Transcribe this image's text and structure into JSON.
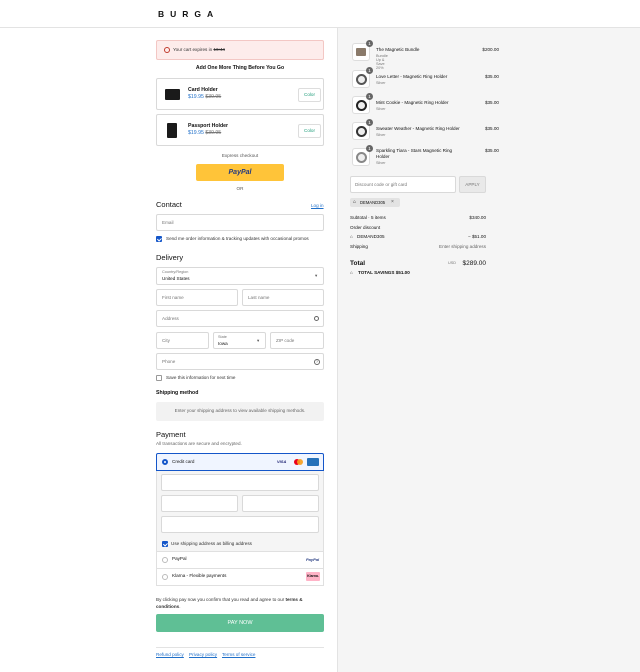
{
  "brand": "BURGA",
  "timer": {
    "prefix": "Your cart expires in",
    "value": "16:44"
  },
  "upsell": {
    "title": "Add One More Thing Before You Go",
    "items": [
      {
        "name": "Card Holder",
        "sale": "$19.95",
        "orig": "$39.95",
        "btn": "Color"
      },
      {
        "name": "Passport Holder",
        "sale": "$19.95",
        "orig": "$39.95",
        "btn": "Color"
      }
    ]
  },
  "express": {
    "label": "Express checkout",
    "paypal": "PayPal",
    "or": "OR"
  },
  "contact": {
    "title": "Contact",
    "login": "Log in",
    "email_ph": "Email",
    "optin": "Send me order information & tracking updates with occasional promos"
  },
  "delivery": {
    "title": "Delivery",
    "country_label": "Country/Region",
    "country": "United States",
    "first_ph": "First name",
    "last_ph": "Last name",
    "address_ph": "Address",
    "city_ph": "City",
    "state_label": "State",
    "state": "Iowa",
    "zip_ph": "ZIP code",
    "phone_ph": "Phone",
    "save": "Save this information for next time"
  },
  "shipping": {
    "title": "Shipping method",
    "msg": "Enter your shipping address to view available shipping methods."
  },
  "payment": {
    "title": "Payment",
    "sub": "All transactions are secure and encrypted.",
    "credit": "Credit card",
    "visa": "VISA",
    "billing": "Use shipping address as billing address",
    "paypal": "PayPal",
    "klarna": "Klarna - Flexible payments",
    "klarna_badge": "Klarna."
  },
  "legal": {
    "pre": "By clicking pay now you confirm that you read and agree to our",
    "terms": "terms & conditions",
    "end": "."
  },
  "paynow": "PAY NOW",
  "footer": [
    "Refund policy",
    "Privacy policy",
    "Terms of service"
  ],
  "cart": {
    "items": [
      {
        "qty": "1",
        "name": "The Magnetic Bundle",
        "variant": "Bundle Up & Save 20%",
        "price": "$200.00"
      },
      {
        "qty": "1",
        "name": "Love Letter - Magnetic Ring Holder",
        "variant": "Silver",
        "price": "$35.00"
      },
      {
        "qty": "1",
        "name": "Mint Cookie - Magnetic Ring Holder",
        "variant": "Silver",
        "price": "$35.00"
      },
      {
        "qty": "1",
        "name": "Sweater Weather - Magnetic Ring Holder",
        "variant": "Silver",
        "price": "$35.00"
      },
      {
        "qty": "1",
        "name": "Sparkling Tiara - Stars Magnetic Ring Holder",
        "variant": "Silver",
        "price": "$35.00"
      }
    ]
  },
  "discount": {
    "ph": "Discount code or gift card",
    "apply": "APPLY",
    "tag": "DEMAND305"
  },
  "summary": {
    "subtotal_label": "Subtotal · 5 items",
    "subtotal": "$340.00",
    "order_discount": "Order discount",
    "code": "DEMAND305",
    "discount": "− $51.00",
    "shipping_label": "Shipping",
    "shipping": "Enter shipping address",
    "total_label": "Total",
    "currency": "USD",
    "total": "$289.00",
    "savings_label": "TOTAL SAVINGS",
    "savings": "$51.00"
  }
}
